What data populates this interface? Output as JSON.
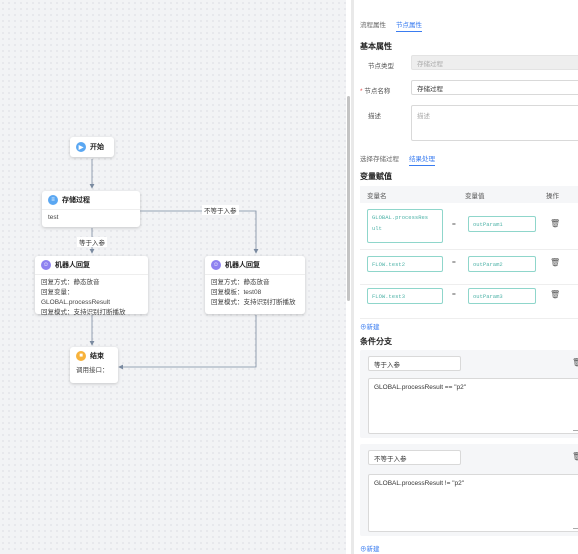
{
  "flow": {
    "start": {
      "label": "开始"
    },
    "stored": {
      "title": "存储过程",
      "body": "test"
    },
    "edge_eq": "等于入参",
    "edge_neq": "不等于入参",
    "robot_left": {
      "title": "机器人回复",
      "lines": [
        "回复方式：静态放音",
        "回复变量：GLOBAL.processResult",
        "回复模式：支持识别打断播放"
      ]
    },
    "robot_right": {
      "title": "机器人回复",
      "lines": [
        "回复方式：静态放音",
        "回复模板：test08",
        "回复模式：支持识别打断播放"
      ]
    },
    "end": {
      "title": "结束",
      "body": "调用接口："
    }
  },
  "panel": {
    "tabs": [
      "流程属性",
      "节点属性"
    ],
    "active_tab": "节点属性",
    "basic_title": "基本属性",
    "node_type_label": "节点类型",
    "node_type_value": "存储过程",
    "node_name_label": "节点名称",
    "node_name_value": "存储过程",
    "desc_label": "描述",
    "desc_placeholder": "描述",
    "subtabs": [
      "选择存储过程",
      "结果处理"
    ],
    "active_subtab": "结果处理",
    "var_title": "变量赋值",
    "table_headers": [
      "变量名",
      "变量值",
      "操作"
    ],
    "rows": [
      {
        "name_lines": [
          "GLOBAL.processRes",
          "ult"
        ],
        "eq": "=",
        "value": "outParam1"
      },
      {
        "name_lines": [
          "FLOW.test2"
        ],
        "eq": "=",
        "value": "outParam2"
      },
      {
        "name_lines": [
          "FLOW.test3"
        ],
        "eq": "=",
        "value": "outParam3"
      }
    ],
    "add_label": "⊕新建",
    "cond_title": "条件分支",
    "branches": [
      {
        "name": "等于入参",
        "expr": "GLOBAL.processResult == \"p2\""
      },
      {
        "name": "不等于入参",
        "expr": "GLOBAL.processResult != \"p2\""
      }
    ],
    "add_label2": "⊕新建"
  }
}
